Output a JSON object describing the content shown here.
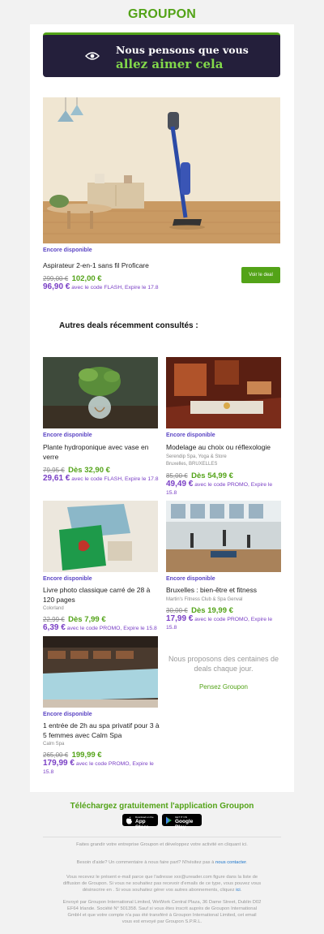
{
  "brand": {
    "logo": "GROUPON",
    "accent": "#53a318",
    "purple": "#7a3fc5",
    "banner_bg": "#241f3b"
  },
  "banner": {
    "line1": "Nous pensons que vous",
    "line2": "allez aimer cela",
    "icon": "eye-icon"
  },
  "hero_deal": {
    "availability": "Encore disponible",
    "title": "Aspirateur 2-en-1 sans fil Proficare",
    "old_price": "299,00 €",
    "price": "102,00 €",
    "promo_price": "96,90 €",
    "promo_text": "avec le code FLASH, Expire le 17.8",
    "button_label": "Voir le deal"
  },
  "section_title": "Autres deals récemment consultés :",
  "deals": [
    {
      "availability": "Encore disponible",
      "title_l1": "Plante hydroponique avec vase en",
      "title_l2": "verre",
      "merchant_l1": "",
      "merchant_l2": "",
      "old_price": "79,95 €",
      "price": "Dès 32,90 €",
      "promo_price": "29,61 €",
      "promo_l1": "avec le code FLASH, Expire le 17.8",
      "promo_l2": ""
    },
    {
      "availability": "Encore disponible",
      "title_l1": "Modelage au choix ou réflexologie",
      "title_l2": "",
      "merchant_l1": "Serendip Spa, Yoga & Store",
      "merchant_l2": "Bruxelles, BRUXELLES",
      "old_price": "85,00 €",
      "price": "Dès 54,99 €",
      "promo_price": "49,49 €",
      "promo_l1": "avec le code PROMO, Expire le",
      "promo_l2": "15.8"
    },
    {
      "availability": "Encore disponible",
      "title_l1": "Livre photo classique carré de 28 à",
      "title_l2": "120 pages",
      "merchant_l1": "Colorland",
      "merchant_l2": "",
      "old_price": "22,99 €",
      "price": "Dès 7,99 €",
      "promo_price": "6,39 €",
      "promo_l1": "avec le code PROMO, Expire le 15.8",
      "promo_l2": ""
    },
    {
      "availability": "Encore disponible",
      "title_l1": "Bruxelles : bien-être et fitness",
      "title_l2": "",
      "merchant_l1": "Martin's Fitness Club & Spa Genval",
      "merchant_l2": "",
      "old_price": "30,00 €",
      "price": "Dès 19,99 €",
      "promo_price": "17,99 €",
      "promo_l1": "avec le code PROMO, Expire le",
      "promo_l2": "15.8"
    },
    {
      "availability": "Encore disponible",
      "title_l1": "1 entrée de 2h au spa privatif pour 3 à",
      "title_l2": "5 femmes avec Calm Spa",
      "merchant_l1": "Calm Spa",
      "merchant_l2": "",
      "old_price": "265,00 €",
      "price": "199,99 €",
      "promo_price": "179,99 €",
      "promo_l1": "avec le code PROMO, Expire le",
      "promo_l2": "15.8"
    }
  ],
  "side": {
    "message_l1": "Nous proposons des centaines de",
    "message_l2": "deals chaque jour.",
    "link": "Pensez Groupon"
  },
  "app": {
    "title": "Téléchargez gratuitement l'application Groupon",
    "appstore_small": "Download on the",
    "appstore": "App Store",
    "googleplay_small": "GET IT ON",
    "googleplay": "Google Play"
  },
  "footer": {
    "p1": "Faites grandir votre entreprise Groupon et développez votre activité en cliquant ici.",
    "p2_text": "Besoin d'aide? Un commentaire à nous faire part? N'hésitez pas à",
    "p2_link": "nous contacter",
    "p3_l1": "Vous recevez le présent e-mail parce que l'adresse xxx@ureader.com figure dans la liste de",
    "p3_l2": "diffusion de Groupon. Si vous ne souhaitez pas recevoir d'emails de ce type, vous pouvez vous",
    "p3_l3": "désinscrire en . Si vous souhaitez gérer vos autres abonnements, cliquez",
    "p3_link": "ici",
    "p4_l1": "Envoyé par Groupon International Limited, WeWork Central Plaza, 36 Dame Street, Dublin D02",
    "p4_l2": "EF64 Irlande. Société N° 501358. Sauf si vous êtes inscrit auprès de Groupon International",
    "p4_l3": "GmbH et que votre compte n'a pas été transféré à Groupon International Limited, cet email",
    "p4_l4": "vous est envoyé par Groupon S.P.R.L."
  }
}
